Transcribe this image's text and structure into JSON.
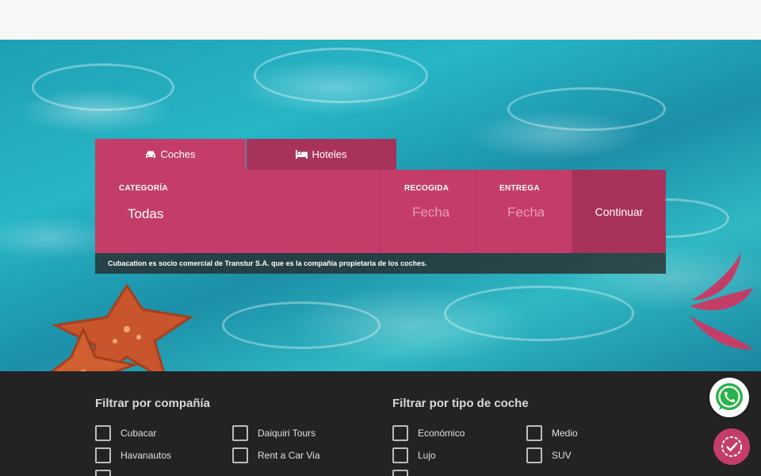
{
  "tabs": {
    "cars": {
      "label": "Coches",
      "icon": "car-icon"
    },
    "hotels": {
      "label": "Hoteles",
      "icon": "bed-icon"
    }
  },
  "form": {
    "category": {
      "label": "CATEGORÍA",
      "value": "Todas"
    },
    "pickup": {
      "label": "RECOGIDA",
      "placeholder": "Fecha"
    },
    "dropoff": {
      "label": "ENTREGA",
      "placeholder": "Fecha"
    },
    "submit_label": "Continuar"
  },
  "note": "Cubacation es socio comercial de Transtur S.A. que es la compañía propietaria de los coches.",
  "filters": {
    "company": {
      "title": "Filtrar por compañía",
      "options": [
        "Cubacar",
        "Daiquiri Tours",
        "Havanautos",
        "Rent a Car Via"
      ]
    },
    "car_type": {
      "title": "Filtrar por tipo de coche",
      "options": [
        "Económico",
        "Medio",
        "Lujo",
        "SUV"
      ]
    }
  },
  "colors": {
    "brand": "#c43d68",
    "brand_dark": "#a8335a",
    "footer_bg": "#232323"
  }
}
